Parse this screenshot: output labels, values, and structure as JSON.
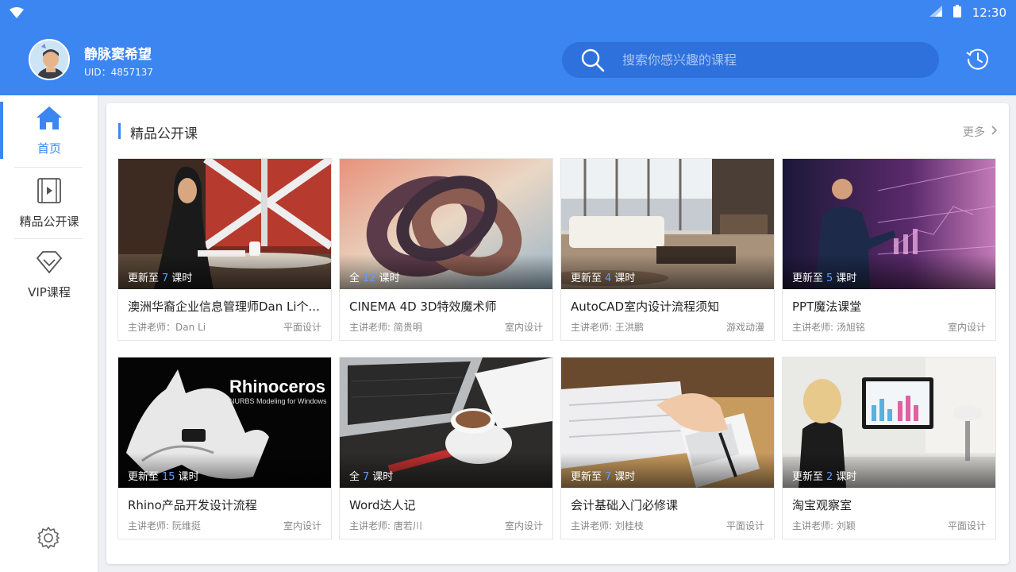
{
  "status": {
    "time": "12:30"
  },
  "user": {
    "name": "静脉窦希望",
    "uid": "UID：4857137"
  },
  "search": {
    "placeholder": "搜索你感兴趣的课程"
  },
  "sidebar": {
    "items": [
      {
        "label": "首页",
        "icon": "home-icon",
        "active": true
      },
      {
        "label": "精品公开课",
        "icon": "video-icon",
        "active": false
      },
      {
        "label": "VIP课程",
        "icon": "vip-diamond-icon",
        "active": false
      }
    ]
  },
  "section": {
    "title": "精品公开课",
    "more": "更多"
  },
  "courses": [
    {
      "badge_pre": "更新至",
      "badge_num": "7",
      "badge_post": "课时",
      "title": "澳洲华裔企业信息管理师Dan Li个...",
      "teacher": "主讲老师：Dan Li",
      "category": "平面设计"
    },
    {
      "badge_pre": "全",
      "badge_num": "12",
      "badge_post": "课时",
      "title": "CINEMA 4D 3D特效魔术师",
      "teacher": "主讲老师: 简贵明",
      "category": "室内设计"
    },
    {
      "badge_pre": "更新至",
      "badge_num": "4",
      "badge_post": "课时",
      "title": "AutoCAD室内设计流程须知",
      "teacher": "主讲老师: 王洪鹏",
      "category": "游戏动漫"
    },
    {
      "badge_pre": "更新至",
      "badge_num": "5",
      "badge_post": "课时",
      "title": "PPT魔法课堂",
      "teacher": "主讲老师: 汤旭铭",
      "category": "室内设计"
    },
    {
      "badge_pre": "更新至",
      "badge_num": "15",
      "badge_post": "课时",
      "title": "Rhino产品开发设计流程",
      "teacher": "主讲老师: 阮维挺",
      "category": "室内设计"
    },
    {
      "badge_pre": "全",
      "badge_num": "7",
      "badge_post": "课时",
      "title": "Word达人记",
      "teacher": "主讲老师: 唐若川",
      "category": "室内设计"
    },
    {
      "badge_pre": "更新至",
      "badge_num": "7",
      "badge_post": "课时",
      "title": "会计基础入门必修课",
      "teacher": "主讲老师: 刘桂枝",
      "category": "平面设计"
    },
    {
      "badge_pre": "更新至",
      "badge_num": "2",
      "badge_post": "课时",
      "title": "淘宝观察室",
      "teacher": "主讲老师: 刘颖",
      "category": "平面设计"
    }
  ],
  "thumb_text": {
    "rhino_logo": "Rhinoceros",
    "rhino_sub": "NURBS Modeling for Windows"
  },
  "colors": {
    "accent": "#3c86f2",
    "header": "#3c86f2",
    "search_bg": "#2f71dc"
  }
}
